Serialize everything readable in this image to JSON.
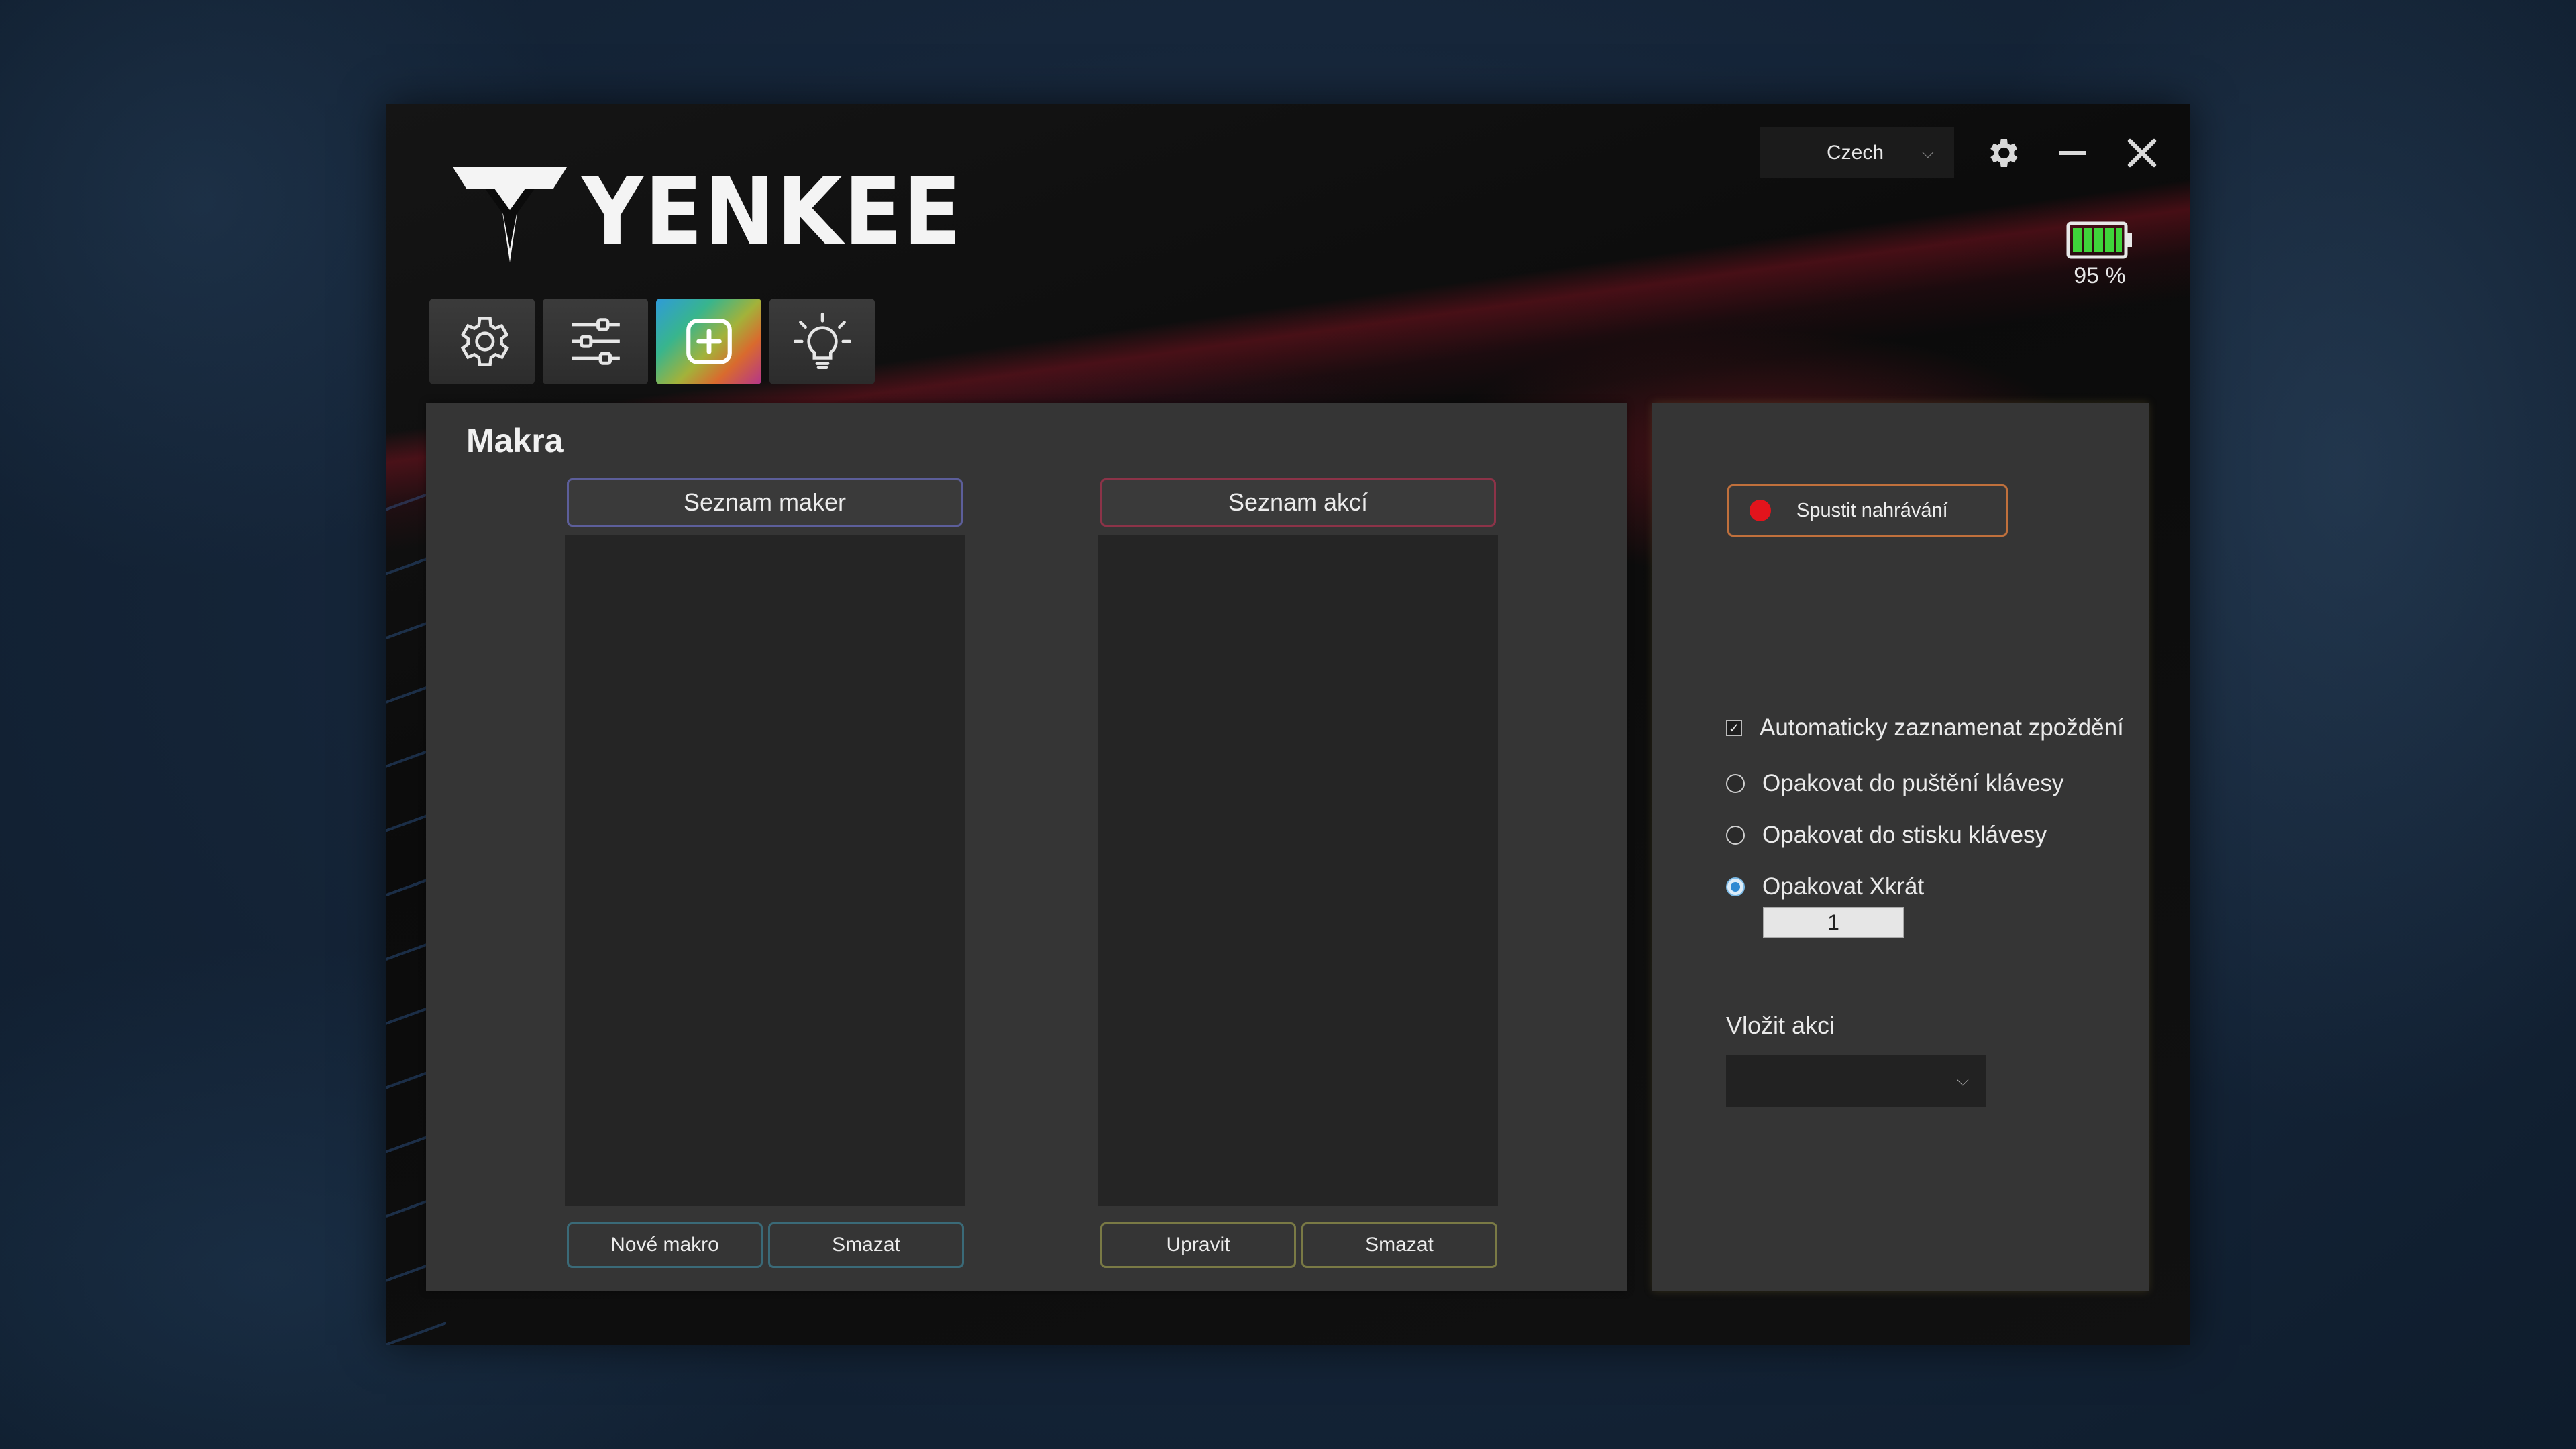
{
  "app": {
    "brand": "YENKEE",
    "language": "Czech",
    "battery_percent": 95,
    "battery_label": "95 %"
  },
  "nav": {
    "items": [
      {
        "name": "settings",
        "icon": "gear-icon"
      },
      {
        "name": "adjustments",
        "icon": "sliders-icon"
      },
      {
        "name": "macros",
        "icon": "plus-square-icon",
        "active": true
      },
      {
        "name": "lighting",
        "icon": "lightbulb-icon"
      }
    ]
  },
  "macros_panel": {
    "title": "Makra",
    "macro_list": {
      "header": "Seznam maker",
      "items": [],
      "new_button": "Nové makro",
      "delete_button": "Smazat"
    },
    "action_list": {
      "header": "Seznam akcí",
      "items": [],
      "edit_button": "Upravit",
      "delete_button": "Smazat"
    }
  },
  "recording_panel": {
    "record_button": "Spustit nahrávání",
    "auto_delay": {
      "label": "Automaticky zaznamenat zpoždění",
      "checked": true
    },
    "repeat_options": [
      {
        "label": "Opakovat do puštění klávesy",
        "checked": false
      },
      {
        "label": "Opakovat do stisku klávesy",
        "checked": false
      },
      {
        "label": "Opakovat Xkrát",
        "checked": true
      }
    ],
    "repeat_count": "1",
    "insert_action_label": "Vložit akci",
    "insert_action_value": ""
  },
  "colors": {
    "accent_record": "#e3141c",
    "battery_green": "#3fd43a",
    "radio_selected": "#2f89d2"
  }
}
